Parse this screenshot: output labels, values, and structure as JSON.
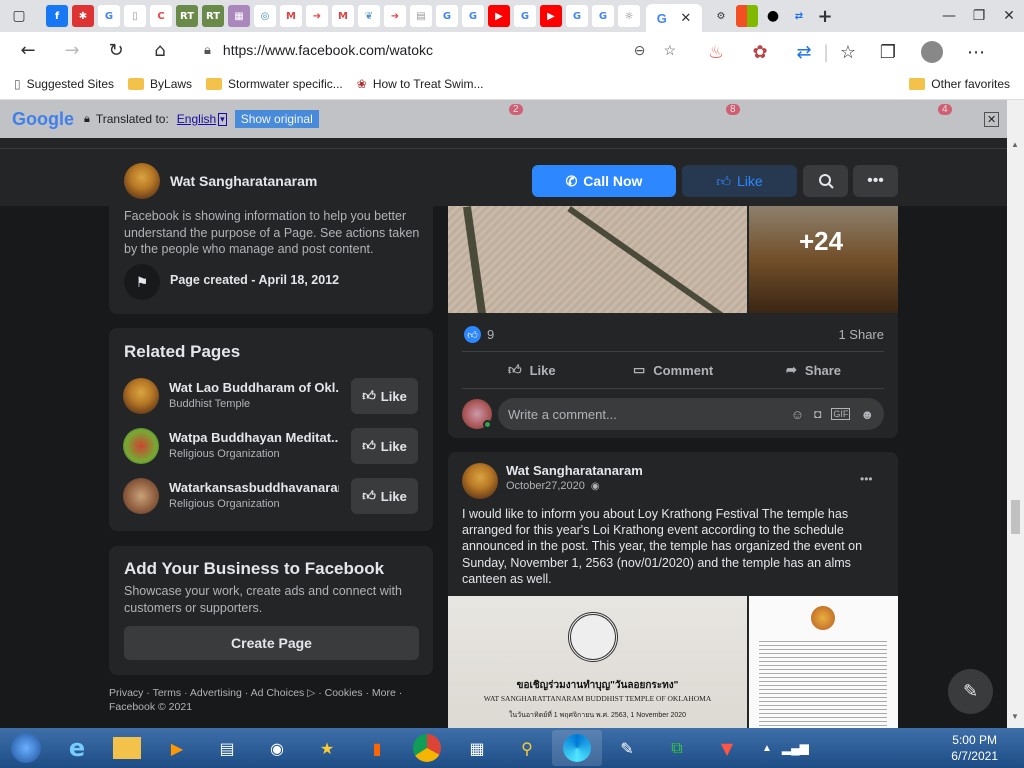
{
  "browser": {
    "url": "https://www.facebook.com/watokc",
    "bookmarks": [
      "Suggested Sites",
      "ByLaws",
      "Stormwater specific...",
      "How to Treat Swim...",
      "Other favorites"
    ]
  },
  "translate": {
    "logo": "Google",
    "translated_to_label": "Translated to:",
    "language": "English",
    "show_original": "Show original"
  },
  "fbnav": {
    "video_badge": "2",
    "groups_badge": "8",
    "notif_badge": "4"
  },
  "page": {
    "name": "Wat Sangharatanaram",
    "call_now": "Call Now",
    "like": "Like"
  },
  "transparency": {
    "text": "Facebook is showing information to help you better understand the purpose of a Page. See actions taken by the people who manage and post content.",
    "created": "Page created - April 18, 2012"
  },
  "related": {
    "title": "Related Pages",
    "items": [
      {
        "name": "Wat Lao Buddharam of Okl...",
        "category": "Buddhist Temple",
        "like": "Like"
      },
      {
        "name": "Watpa Buddhayan Meditat...",
        "category": "Religious Organization",
        "like": "Like"
      },
      {
        "name": "Watarkansasbuddhavanaram",
        "category": "Religious Organization",
        "like": "Like"
      }
    ]
  },
  "business": {
    "title": "Add Your Business to Facebook",
    "text": "Showcase your work, create ads and connect with customers or supporters.",
    "button": "Create Page"
  },
  "footer": {
    "line1": "Privacy · Terms · Advertising · Ad Choices ▷ · Cookies · More ·",
    "line2": "Facebook © 2021"
  },
  "post1": {
    "more_photos": "+24",
    "likes": "9",
    "shares": "1 Share",
    "like": "Like",
    "comment": "Comment",
    "share": "Share",
    "comment_placeholder": "Write a comment..."
  },
  "post2": {
    "author": "Wat Sangharatanaram",
    "date": "October27,2020",
    "text": "I would like to inform you about Loy Krathong Festival The temple has arranged for this year's Loi Krathong event according to the schedule announced in the post. This year, the temple has organized the event on Sunday, November 1, 2563 (nov/01/2020) and the temple has an alms canteen as well.",
    "img_line1": "ขอเชิญร่วมงานทำบุญ\"วันลอยกระทง\"",
    "img_line2": "WAT SANGHARATTANARAM BUDDHIST TEMPLE OF OKLAHOMA",
    "img_line3": "ในวันอาทิตย์ที่ 1 พฤศจิกายน พ.ศ. 2563, 1 November 2020"
  },
  "taskbar": {
    "time": "5:00 PM",
    "date": "6/7/2021"
  },
  "colors": {
    "fb_blue": "#2d88ff",
    "card": "#242526",
    "bg": "#18191a",
    "text": "#e4e6eb",
    "secondary": "#b0b3b8"
  }
}
